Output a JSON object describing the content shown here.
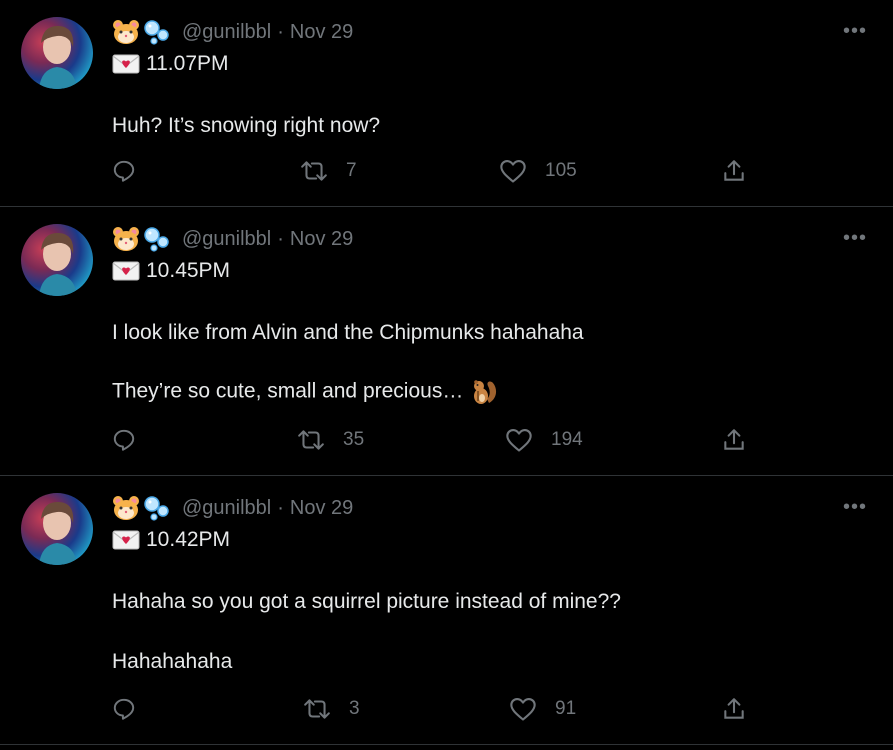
{
  "tweets": [
    {
      "handle": "@gunilbbl",
      "separator": "·",
      "date": "Nov 29",
      "time": "11.07PM",
      "lines": [
        "Huh? It’s snowing right now?"
      ],
      "replies": "",
      "retweets": "7",
      "likes": "105",
      "more": "•••"
    },
    {
      "handle": "@gunilbbl",
      "separator": "·",
      "date": "Nov 29",
      "time": "10.45PM",
      "lines": [
        "I look like from Alvin and the Chipmunks hahahaha",
        "They’re so cute, small and precious…"
      ],
      "replies": "",
      "retweets": "35",
      "likes": "194",
      "more": "•••"
    },
    {
      "handle": "@gunilbbl",
      "separator": "·",
      "date": "Nov 29",
      "time": "10.42PM",
      "lines": [
        "Hahaha so you got a squirrel picture instead of mine??",
        "Hahahahaha"
      ],
      "replies": "",
      "retweets": "3",
      "likes": "91",
      "more": "•••"
    }
  ],
  "icons": {
    "name_emojis": [
      "hamster-face-icon",
      "bubbles-icon"
    ],
    "time_emoji": "love-letter-icon",
    "inline_emoji": "chipmunk-icon",
    "actions": [
      "reply-icon",
      "retweet-icon",
      "like-icon",
      "share-icon"
    ]
  },
  "colors": {
    "background": "#000000",
    "text": "#e7e9ea",
    "muted": "#71767b",
    "divider": "#2f3336"
  }
}
